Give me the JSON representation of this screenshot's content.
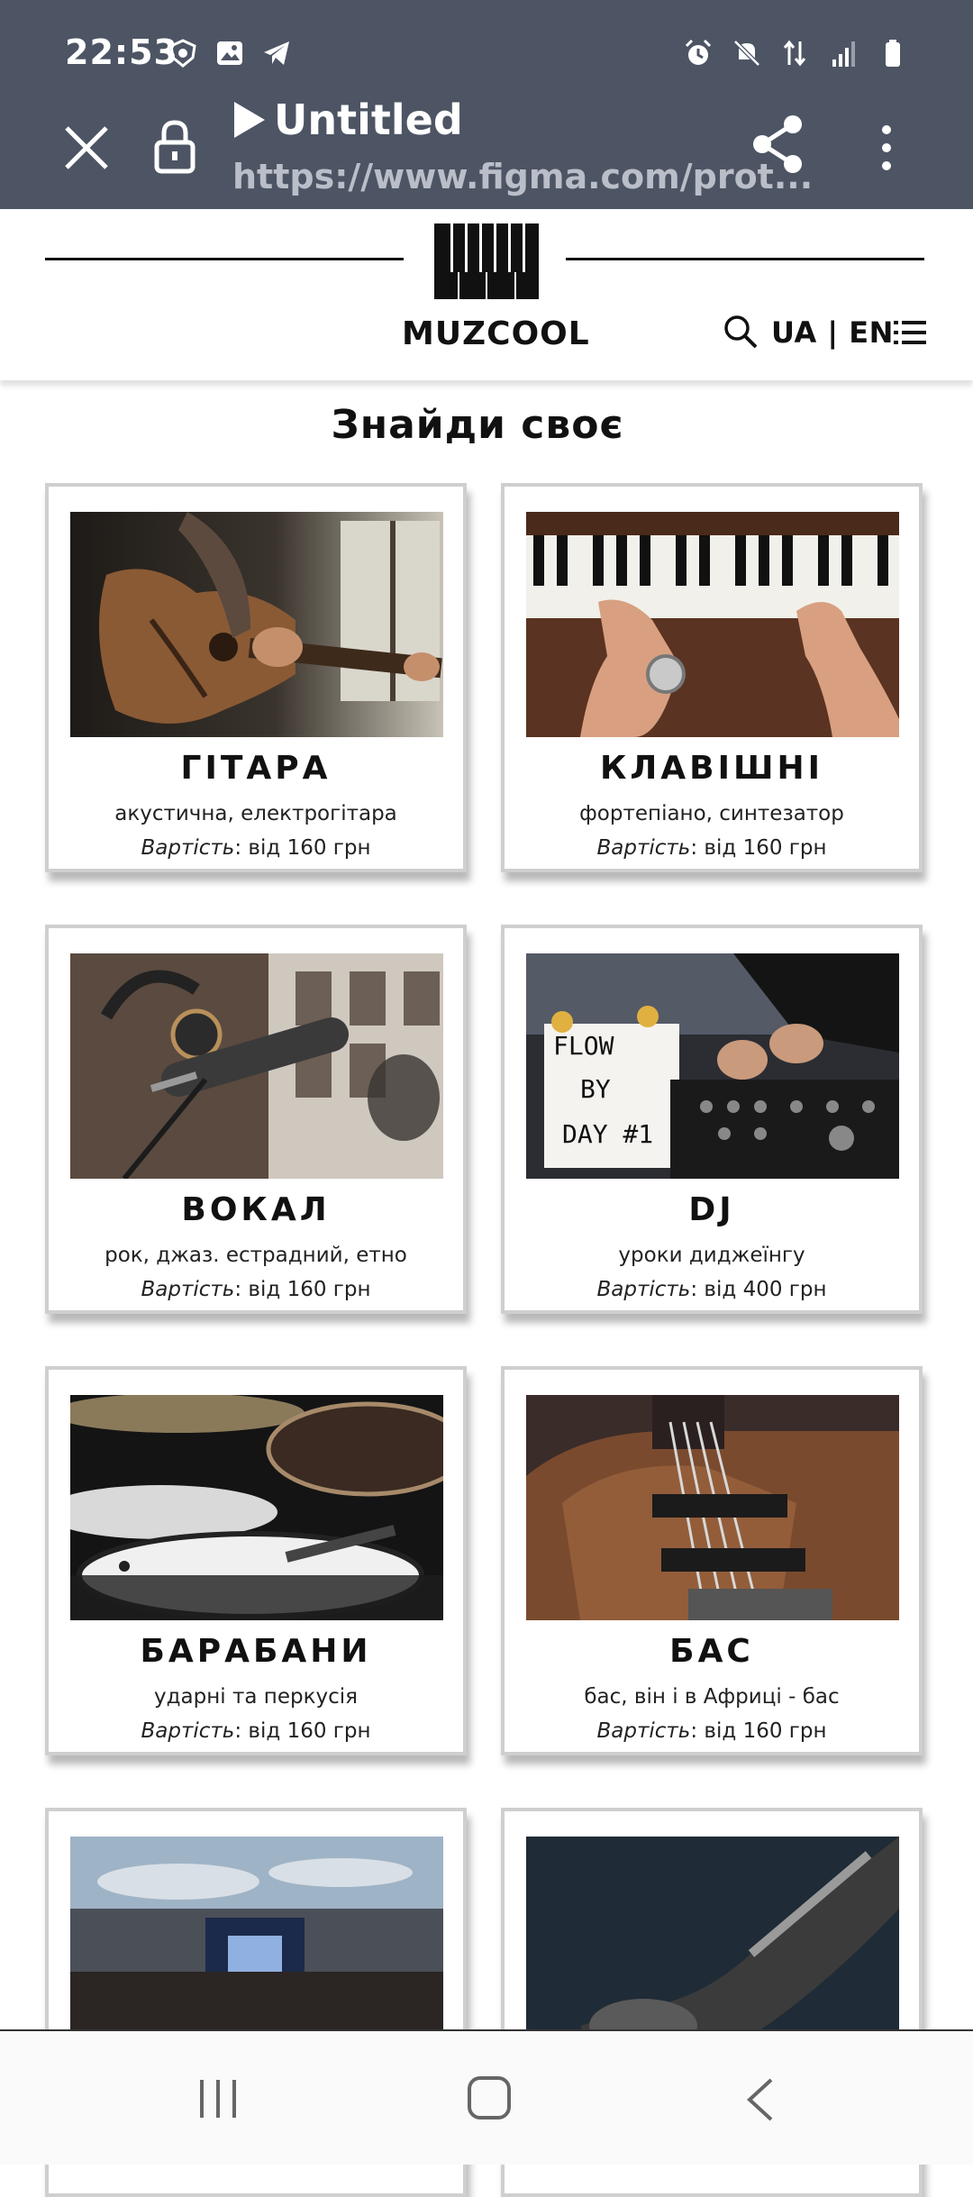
{
  "status_bar": {
    "time": "22:53",
    "left_icons": [
      "shield-app-icon",
      "gallery-icon",
      "telegram-icon"
    ],
    "right_icons": [
      "alarm-icon",
      "mute-icon",
      "data-arrows-icon",
      "signal-icon",
      "battery-icon"
    ]
  },
  "browser": {
    "page_title": "Untitled",
    "url": "https://www.figma.com/prot..."
  },
  "site": {
    "logo_text": "MUZCOOL",
    "language": "UA | EN",
    "section_title": "Знайди своє"
  },
  "cards": [
    {
      "name": "ГІТАРА",
      "desc": "акустична, електрогітара",
      "price_label": "Вартість",
      "price_value": ": від 160 грн"
    },
    {
      "name": "КЛАВІШНІ",
      "desc": "фортепіано, синтезатор",
      "price_label": "Вартість",
      "price_value": ": від 160 грн"
    },
    {
      "name": "ВОКАЛ",
      "desc": "рок, джаз. естрадний, етно",
      "price_label": "Вартість",
      "price_value": ": від 160 грн"
    },
    {
      "name": "DJ",
      "desc": "уроки диджеїнгу",
      "price_label": "Вартість",
      "price_value": ": від 400 грн"
    },
    {
      "name": "БАРАБАНИ",
      "desc": "ударні та перкусія",
      "price_label": "Вартість",
      "price_value": ": від 160 грн"
    },
    {
      "name": "БАС",
      "desc": "бас, він і в Африці - бас",
      "price_label": "Вартість",
      "price_value": ": від 160 грн"
    }
  ],
  "lightbox_text": "FLOW BY DAY #1"
}
